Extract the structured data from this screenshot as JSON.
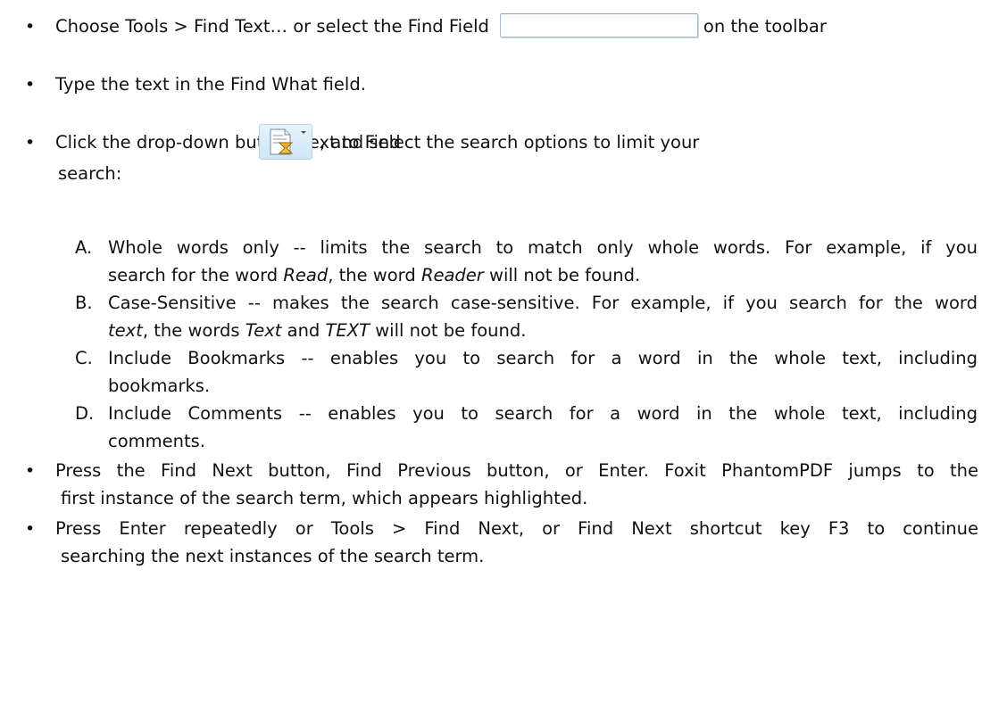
{
  "bullet_char": "•",
  "items": [
    {
      "pre": "Choose Tools > Find Text… or select the Find Field",
      "post": "on the toolbar"
    },
    {
      "text": "Type the text in the Find What field."
    },
    {
      "pre": "Click the drop-down button next to Find",
      "post": ", and select the search options to limit your",
      "line2": "search:"
    }
  ],
  "options": [
    {
      "marker": "A.",
      "line1": "Whole words only -- limits the search to match only whole words. For example, if you",
      "line2_a": "search for the word ",
      "line2_em1": "Read",
      "line2_b": ", the word ",
      "line2_em2": "Reader",
      "line2_c": " will not be found."
    },
    {
      "marker": "B.",
      "line1": "Case-Sensitive -- makes the search case-sensitive. For example, if you search for the word",
      "line2_em1": "text",
      "line2_a": ", the words ",
      "line2_em2": "Text",
      "line2_b": " and ",
      "line2_em3": "TEXT",
      "line2_c": " will not be found."
    },
    {
      "marker": "C.",
      "line1": "Include Bookmarks -- enables you to search for a word in the whole text, including",
      "line2": "bookmarks."
    },
    {
      "marker": "D.",
      "line1": "Include Comments -- enables you to search for a word in the whole text, including",
      "line2": "comments."
    }
  ],
  "final_items": [
    {
      "line1": "Press the Find Next button, Find Previous button, or Enter. Foxit PhantomPDF jumps to the",
      "line2": "first instance of the search term, which appears highlighted."
    },
    {
      "line1": "Press Enter repeatedly or Tools > Find Next, or Find Next shortcut key F3 to continue",
      "line2": "searching the next instances of the search term."
    }
  ],
  "icons": {
    "find_field": "find-field-input",
    "find_button": "find-document-icon"
  }
}
